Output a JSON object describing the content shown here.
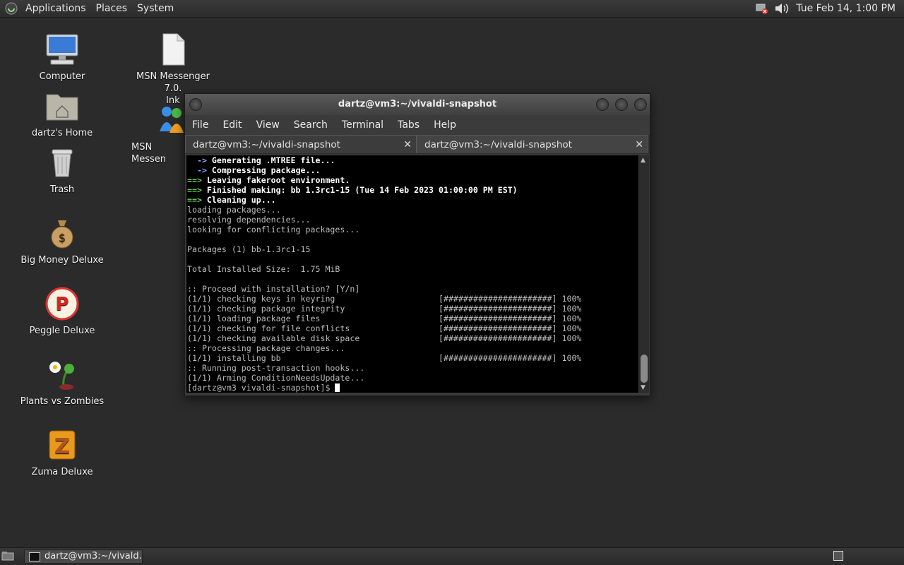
{
  "top_panel": {
    "menus": [
      "Applications",
      "Places",
      "System"
    ],
    "clock": "Tue Feb 14,  1:00 PM",
    "tray_icons": [
      "network-error-icon",
      "volume-icon"
    ]
  },
  "desktop": {
    "icons": [
      {
        "label": "Computer",
        "icon": "computer-icon"
      },
      {
        "label": "dartz's Home",
        "icon": "home-folder-icon"
      },
      {
        "label": "Trash",
        "icon": "trash-icon"
      },
      {
        "label": "Big Money Deluxe",
        "icon": "money-bag-icon"
      },
      {
        "label": "Peggle Deluxe",
        "icon": "peggle-icon"
      },
      {
        "label": "Plants vs Zombies",
        "icon": "plants-icon"
      },
      {
        "label": "Zuma Deluxe",
        "icon": "zuma-icon"
      },
      {
        "label": "MSN Messenger 7.0.\nlnk",
        "icon": "file-icon"
      },
      {
        "label": "MSN Messen",
        "icon": "msn-messenger-icon"
      }
    ]
  },
  "terminal": {
    "title": "dartz@vm3:~/vivaldi-snapshot",
    "menu": [
      "File",
      "Edit",
      "View",
      "Search",
      "Terminal",
      "Tabs",
      "Help"
    ],
    "tabs": [
      "dartz@vm3:~/vivaldi-snapshot",
      "dartz@vm3:~/vivaldi-snapshot"
    ],
    "lines": [
      {
        "p": "  -> ",
        "pc": "bl",
        "t": "Generating .MTREE file...",
        "tc": "b"
      },
      {
        "p": "  -> ",
        "pc": "bl",
        "t": "Compressing package...",
        "tc": "b"
      },
      {
        "p": "==> ",
        "pc": "g",
        "t": "Leaving fakeroot environment.",
        "tc": "b"
      },
      {
        "p": "==> ",
        "pc": "g",
        "t": "Finished making: bb 1.3rc1-15 (Tue 14 Feb 2023 01:00:00 PM EST)",
        "tc": "b"
      },
      {
        "p": "==> ",
        "pc": "g",
        "t": "Cleaning up...",
        "tc": "b"
      },
      {
        "t": "loading packages..."
      },
      {
        "t": "resolving dependencies..."
      },
      {
        "t": "looking for conflicting packages..."
      },
      {
        "t": ""
      },
      {
        "t": "Packages (1) bb-1.3rc1-15"
      },
      {
        "t": ""
      },
      {
        "t": "Total Installed Size:  1.75 MiB"
      },
      {
        "t": ""
      },
      {
        "t": ":: Proceed with installation? [Y/n]"
      },
      {
        "t": "(1/1) checking keys in keyring                     [######################] 100%"
      },
      {
        "t": "(1/1) checking package integrity                   [######################] 100%"
      },
      {
        "t": "(1/1) loading package files                        [######################] 100%"
      },
      {
        "t": "(1/1) checking for file conflicts                  [######################] 100%"
      },
      {
        "t": "(1/1) checking available disk space                [######################] 100%"
      },
      {
        "t": ":: Processing package changes..."
      },
      {
        "t": "(1/1) installing bb                                [######################] 100%"
      },
      {
        "t": ":: Running post-transaction hooks..."
      },
      {
        "t": "(1/1) Arming ConditionNeedsUpdate..."
      }
    ],
    "prompt": "[dartz@vm3 vivaldi-snapshot]$ "
  },
  "bottom_panel": {
    "task": "dartz@vm3:~/vivald..."
  }
}
